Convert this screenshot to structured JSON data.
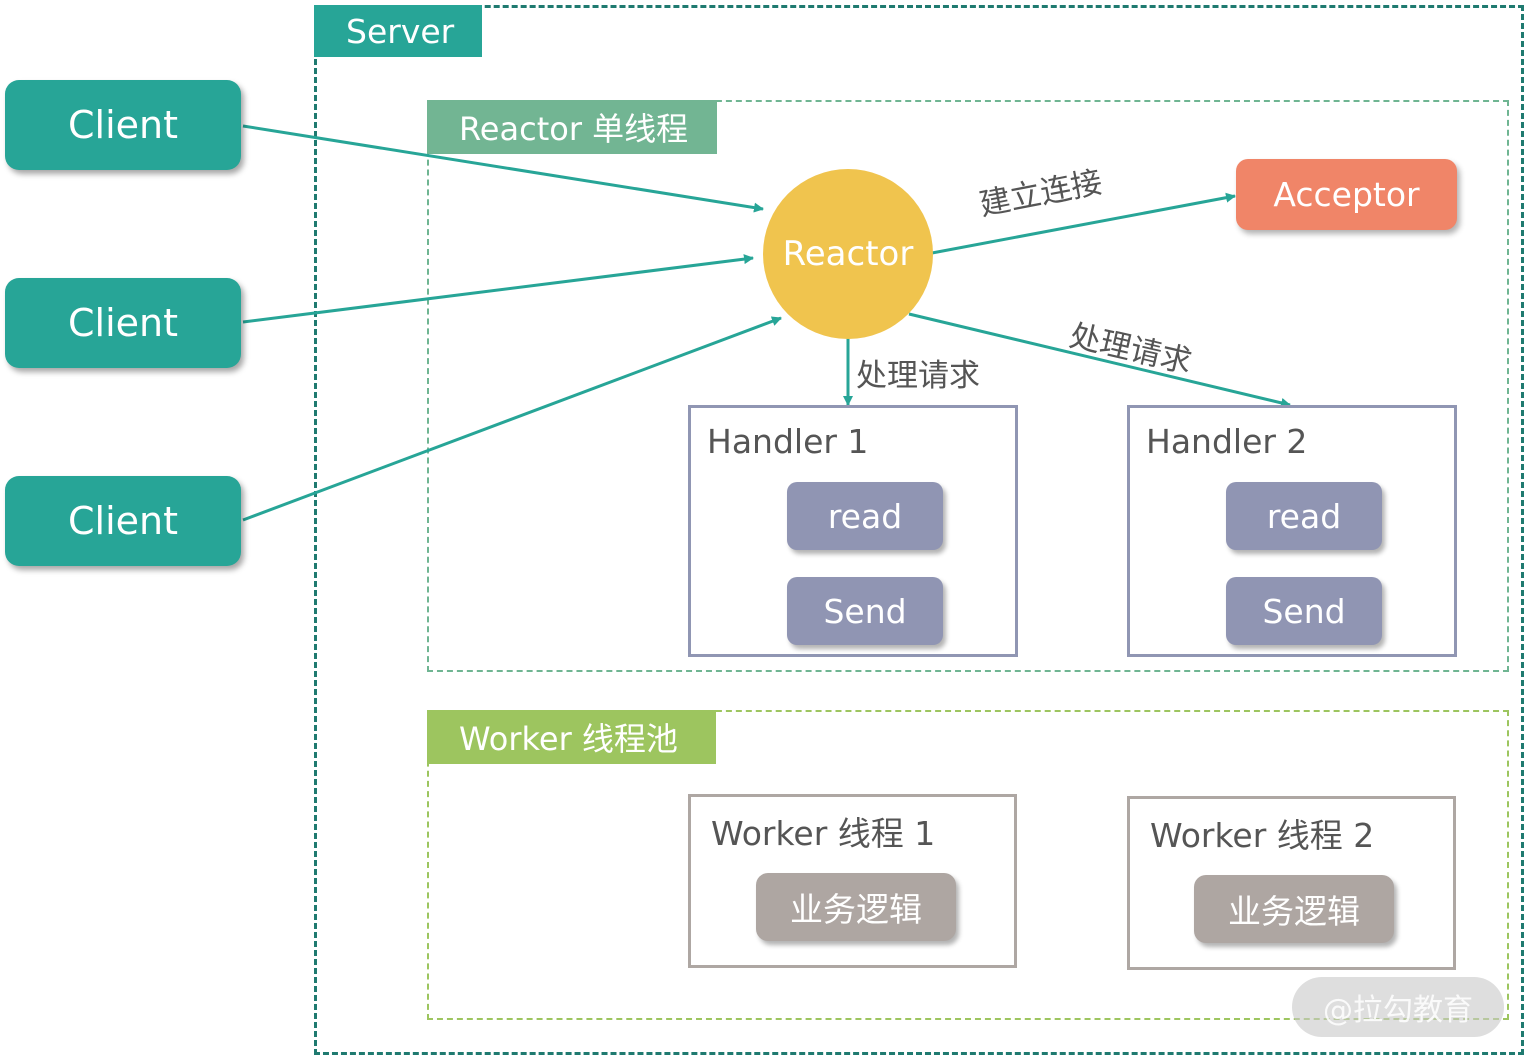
{
  "server": {
    "label": "Server"
  },
  "reactor_group": {
    "label": "Reactor 单线程"
  },
  "worker_group": {
    "label": "Worker 线程池"
  },
  "clients": [
    {
      "label": "Client"
    },
    {
      "label": "Client"
    },
    {
      "label": "Client"
    }
  ],
  "reactor": {
    "label": "Reactor"
  },
  "acceptor": {
    "label": "Acceptor"
  },
  "edges": {
    "connect_label": "建立连接",
    "handle_label_1": "处理请求",
    "handle_label_2": "处理请求"
  },
  "handlers": [
    {
      "title": "Handler 1",
      "ops": [
        "read",
        "Send"
      ]
    },
    {
      "title": "Handler 2",
      "ops": [
        "read",
        "Send"
      ]
    }
  ],
  "workers": [
    {
      "title": "Worker 线程 1",
      "task": "业务逻辑"
    },
    {
      "title": "Worker 线程 2",
      "task": "业务逻辑"
    }
  ],
  "colors": {
    "client": "#27a597",
    "reactor": "#f0c44e",
    "acceptor": "#f08568",
    "arrow": "#27a597",
    "handler_op": "#9095b3",
    "worker_task": "#aea6a2"
  },
  "watermark": "@拉勾教育"
}
